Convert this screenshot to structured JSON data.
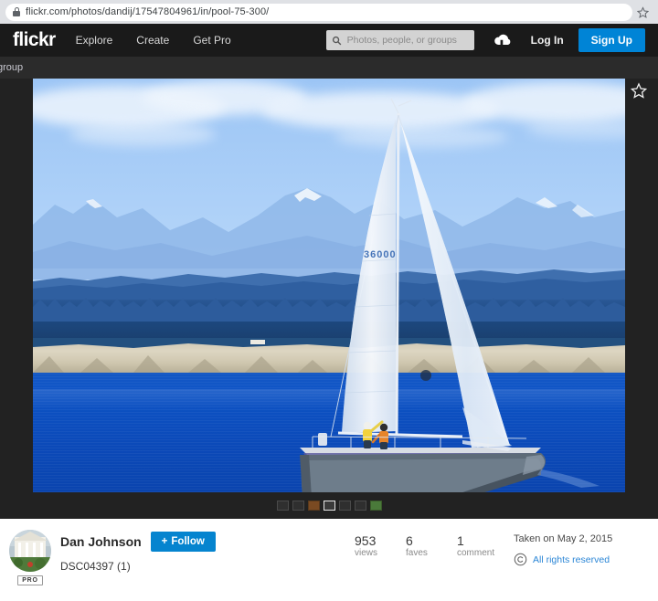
{
  "browser": {
    "url": "flickr.com/photos/dandij/17547804961/in/pool-75-300/",
    "lock_icon": "lock-icon",
    "bookmark_icon": "star-icon"
  },
  "header": {
    "logo": "flickr",
    "nav": [
      {
        "label": "Explore"
      },
      {
        "label": "Create"
      },
      {
        "label": "Get Pro"
      }
    ],
    "search": {
      "placeholder": "Photos, people, or groups",
      "icon": "search-icon",
      "value": ""
    },
    "upload_icon": "cloud-upload-icon",
    "login_label": "Log In",
    "signup_label": "Sign Up",
    "background": "#1a1a1a",
    "signup_color": "#0084d6"
  },
  "breadcrumb": {
    "label": "group"
  },
  "photo": {
    "alt": "Sailboat with white sails on deep blue water, forested shoreline bluffs and hazy blue mountains under a light blue sky with white clouds",
    "sail_number": "36000",
    "background": "#222222"
  },
  "filmstrip": {
    "thumbs": [
      {
        "name": "thumbnail-1",
        "kind": "dark",
        "selected": false
      },
      {
        "name": "thumbnail-2",
        "kind": "dark",
        "selected": false
      },
      {
        "name": "thumbnail-3",
        "kind": "brown",
        "selected": false
      },
      {
        "name": "thumbnail-4",
        "kind": "dark",
        "selected": true
      },
      {
        "name": "thumbnail-5",
        "kind": "dark",
        "selected": false
      },
      {
        "name": "thumbnail-6",
        "kind": "dark",
        "selected": false
      },
      {
        "name": "thumbnail-7",
        "kind": "green",
        "selected": false
      }
    ],
    "favorite_icon": "star-outline-icon"
  },
  "owner": {
    "avatar_alt": "White house with porch and green garden",
    "pro_badge": "PRO",
    "name": "Dan Johnson",
    "follow_label": "Follow",
    "follow_plus": "+",
    "follow_color": "#0584cf",
    "photo_title": "DSC04397 (1)"
  },
  "stats": [
    {
      "number": "953",
      "label": "views"
    },
    {
      "number": "6",
      "label": "faves"
    },
    {
      "number": "1",
      "label": "comment"
    }
  ],
  "meta": {
    "taken_on": "Taken on May 2, 2015",
    "rights_icon": "copyright-icon",
    "rights": "All rights reserved",
    "rights_color": "#2b86d6"
  }
}
